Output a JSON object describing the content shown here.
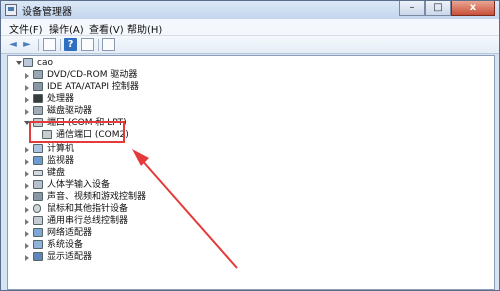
{
  "window": {
    "title": "设备管理器",
    "min": "–",
    "max": "□",
    "close": "x"
  },
  "menu": [
    "文件(F)",
    "操作(A)",
    "查看(V)",
    "帮助(H)"
  ],
  "toolbar": {
    "back": "◄",
    "forward": "►",
    "help": "?"
  },
  "tree": {
    "root": "cao",
    "items": [
      "DVD/CD-ROM 驱动器",
      "IDE ATA/ATAPI 控制器",
      "处理器",
      "磁盘驱动器",
      "端口 (COM 和 LPT)",
      "通信端口 (COM2)",
      "计算机",
      "监视器",
      "键盘",
      "人体学输入设备",
      "声音、视频和游戏控制器",
      "鼠标和其他指针设备",
      "通用串行总线控制器",
      "网络适配器",
      "系统设备",
      "显示适配器"
    ]
  },
  "colors": {
    "annotation": "#e53a3a"
  }
}
